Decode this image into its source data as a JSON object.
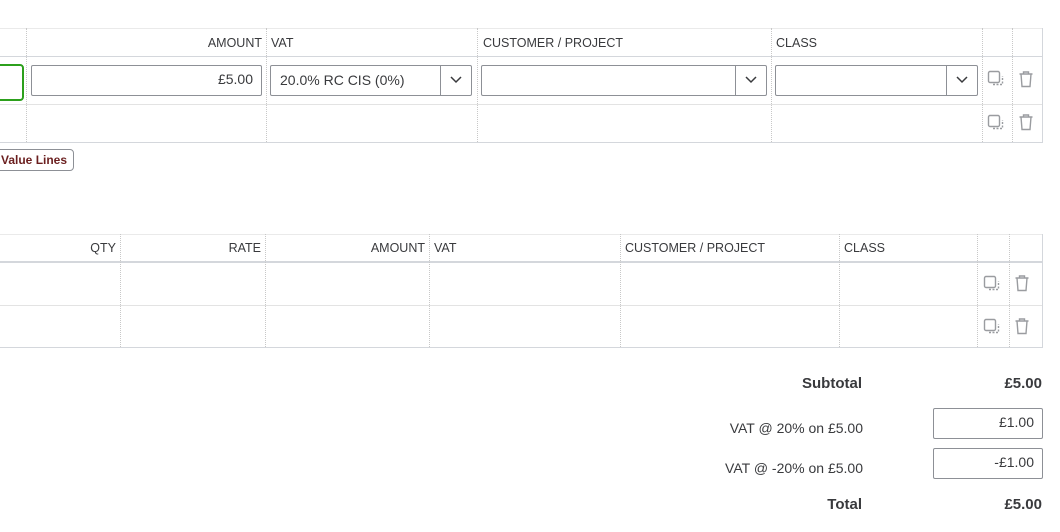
{
  "table1": {
    "headers": {
      "amount": "AMOUNT",
      "vat": "VAT",
      "customer": "CUSTOMER / PROJECT",
      "class": "CLASS"
    },
    "row1": {
      "amount": "£5.00",
      "vat": "20.0% RC CIS (0%)",
      "customer": "",
      "class": ""
    },
    "value_lines_button": "Value Lines"
  },
  "table2": {
    "headers": {
      "qty": "QTY",
      "rate": "RATE",
      "amount": "AMOUNT",
      "vat": "VAT",
      "customer": "CUSTOMER / PROJECT",
      "class": "CLASS"
    }
  },
  "totals": {
    "subtotal_label": "Subtotal",
    "subtotal_value": "£5.00",
    "vat1_label": "VAT @ 20% on £5.00",
    "vat1_value": "£1.00",
    "vat2_label": "VAT @ -20% on £5.00",
    "vat2_value": "-£1.00",
    "total_label": "Total",
    "total_value": "£5.00"
  },
  "icons": [
    "copy-icon",
    "trash-icon",
    "chevron-down-icon"
  ],
  "colors": {
    "focus_border": "#2ca01c",
    "button_text": "#6b1f1f",
    "border": "#8d9096"
  }
}
